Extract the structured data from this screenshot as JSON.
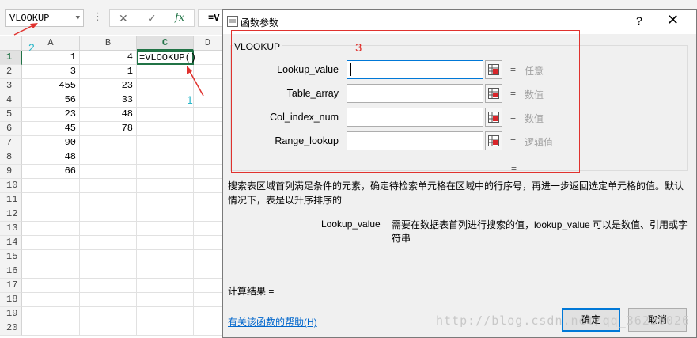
{
  "excel": {
    "name_box": "VLOOKUP",
    "formula_prefix": "=V",
    "columns": [
      "A",
      "B",
      "C",
      "D"
    ],
    "active_column": "C",
    "rows": [
      {
        "num": "1",
        "a": "1",
        "b": "4",
        "c": "=VLOOKUP()"
      },
      {
        "num": "2",
        "a": "3",
        "b": "1",
        "c": ""
      },
      {
        "num": "3",
        "a": "455",
        "b": "23",
        "c": ""
      },
      {
        "num": "4",
        "a": "56",
        "b": "33",
        "c": ""
      },
      {
        "num": "5",
        "a": "23",
        "b": "48",
        "c": ""
      },
      {
        "num": "6",
        "a": "45",
        "b": "78",
        "c": ""
      },
      {
        "num": "7",
        "a": "90",
        "b": "",
        "c": ""
      },
      {
        "num": "8",
        "a": "48",
        "b": "",
        "c": ""
      },
      {
        "num": "9",
        "a": "66",
        "b": "",
        "c": ""
      },
      {
        "num": "10",
        "a": "",
        "b": "",
        "c": ""
      },
      {
        "num": "11",
        "a": "",
        "b": "",
        "c": ""
      },
      {
        "num": "12",
        "a": "",
        "b": "",
        "c": ""
      },
      {
        "num": "13",
        "a": "",
        "b": "",
        "c": ""
      },
      {
        "num": "14",
        "a": "",
        "b": "",
        "c": ""
      },
      {
        "num": "15",
        "a": "",
        "b": "",
        "c": ""
      },
      {
        "num": "16",
        "a": "",
        "b": "",
        "c": ""
      },
      {
        "num": "17",
        "a": "",
        "b": "",
        "c": ""
      },
      {
        "num": "18",
        "a": "",
        "b": "",
        "c": ""
      },
      {
        "num": "19",
        "a": "",
        "b": "",
        "c": ""
      },
      {
        "num": "20",
        "a": "",
        "b": "",
        "c": ""
      }
    ],
    "annotations": {
      "one": "1",
      "two": "2",
      "three": "3"
    }
  },
  "dialog": {
    "title": "函数参数",
    "help": "?",
    "close": "✕",
    "function_name": "VLOOKUP",
    "args": [
      {
        "label": "Lookup_value",
        "value": "",
        "eq": "=",
        "type": "任意"
      },
      {
        "label": "Table_array",
        "value": "",
        "eq": "=",
        "type": "数值"
      },
      {
        "label": "Col_index_num",
        "value": "",
        "eq": "=",
        "type": "数值"
      },
      {
        "label": "Range_lookup",
        "value": "",
        "eq": "=",
        "type": "逻辑值"
      }
    ],
    "result_eq": "=",
    "description": "搜索表区域首列满足条件的元素，确定待检索单元格在区域中的行序号，再进一步返回选定单元格的值。默认情况下，表是以升序排序的",
    "arg_name": "Lookup_value",
    "arg_description": "需要在数据表首列进行搜索的值，lookup_value 可以是数值、引用或字符串",
    "calc_result": "计算结果 =",
    "help_link": "有关该函数的帮助(H)",
    "ok": "确定",
    "cancel": "取消"
  },
  "watermark": "http://blog.csdn.net/qq_36236026",
  "colors": {
    "accent_green": "#217346",
    "annotation_red": "#e0322e",
    "annotation_cyan": "#2bb7c9",
    "link_blue": "#0066cc"
  }
}
